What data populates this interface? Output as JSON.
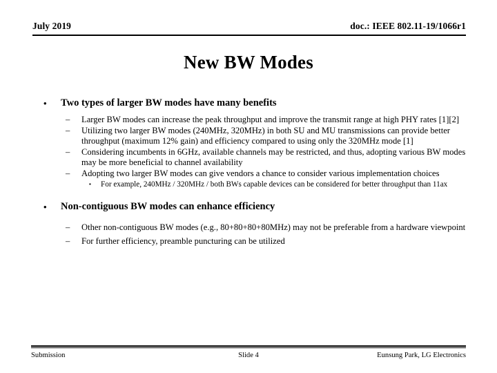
{
  "header": {
    "date": "July 2019",
    "doc": "doc.: IEEE 802.11-19/1066r1"
  },
  "title": "New BW Modes",
  "markers": {
    "level1": "•",
    "level2": "–",
    "level3": "▪"
  },
  "content": {
    "section1": {
      "heading": "Two types of larger BW modes have many benefits",
      "points": [
        "Larger BW modes can increase the peak throughput and improve the transmit range at high PHY rates [1][2]",
        "Utilizing two larger BW modes (240MHz, 320MHz) in both SU and MU transmissions can provide better throughput (maximum 12% gain) and efficiency compared to using only the 320MHz mode [1]",
        "Considering incumbents in 6GHz, available channels may be restricted, and thus, adopting various BW modes may be more beneficial to channel availability",
        "Adopting two larger BW modes can give vendors a chance to consider various implementation choices"
      ],
      "subpoint": "For example, 240MHz / 320MHz / both BWs capable devices can be considered for better throughput than 11ax"
    },
    "section2": {
      "heading": "Non-contiguous BW modes can enhance efficiency",
      "points": [
        "Other non-contiguous BW modes (e.g., 80+80+80+80MHz) may not be preferable from a hardware viewpoint",
        "For further efficiency, preamble puncturing can be utilized"
      ]
    }
  },
  "footer": {
    "left": "Submission",
    "center": "Slide 4",
    "right": "Eunsung Park, LG Electronics"
  }
}
